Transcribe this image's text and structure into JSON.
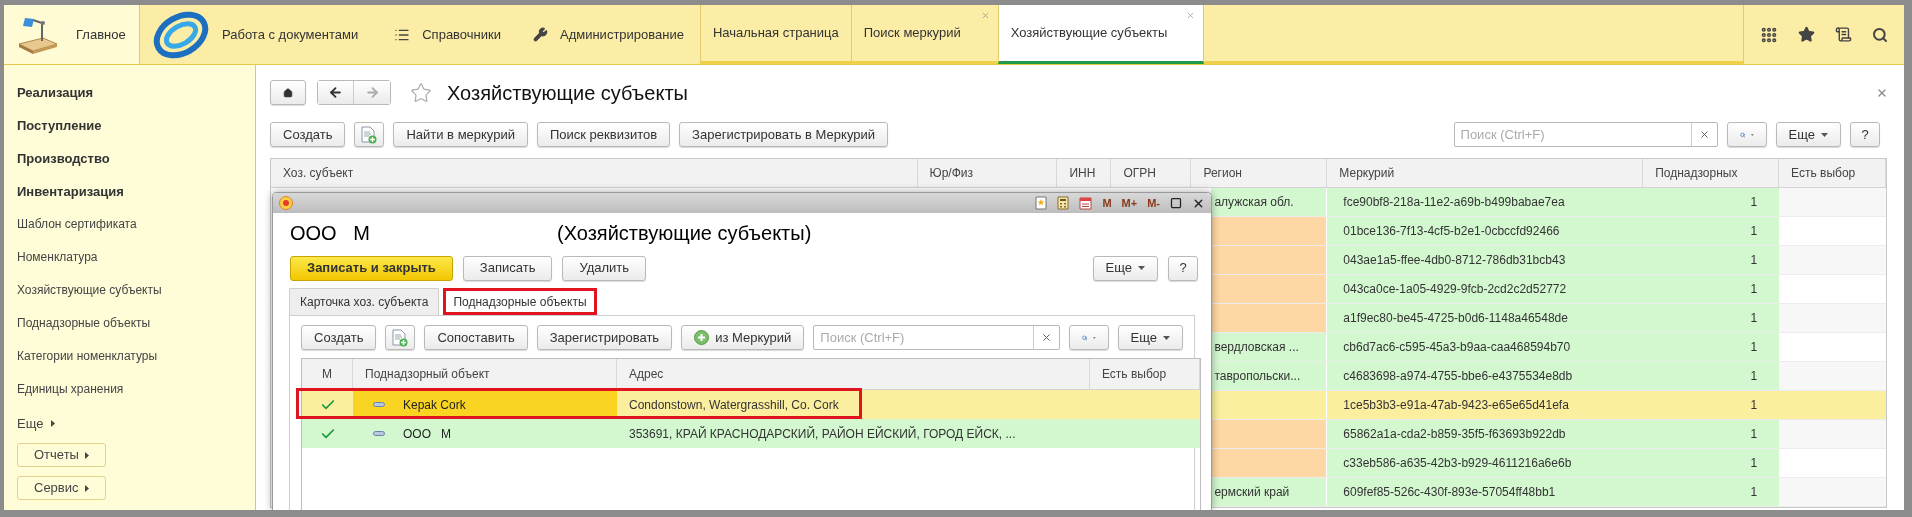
{
  "top_bar": {
    "home": {
      "label": "Главное"
    },
    "sections": [
      {
        "label": "Работа с документами",
        "kind": "logo"
      },
      {
        "label": "Справочники",
        "kind": "list"
      },
      {
        "label": "Администрирование",
        "kind": "wrench"
      }
    ],
    "tabs": [
      {
        "label": "Начальная страница",
        "selected": false,
        "closable": false
      },
      {
        "label": "Поиск меркурий",
        "selected": false,
        "closable": true
      },
      {
        "label": "Хозяйствующие субъекты",
        "selected": true,
        "closable": true
      }
    ]
  },
  "sidebar": {
    "items": [
      {
        "label": "Реализация",
        "kind": "section"
      },
      {
        "label": "Поступление",
        "kind": "section"
      },
      {
        "label": "Производство",
        "kind": "section"
      },
      {
        "label": "Инвентаризация",
        "kind": "section"
      },
      {
        "label": "Шаблон сертификата",
        "kind": "link"
      },
      {
        "label": "Номенклатура",
        "kind": "link"
      },
      {
        "label": "Хозяйствующие субъекты",
        "kind": "link"
      },
      {
        "label": "Поднадзорные объекты",
        "kind": "link"
      },
      {
        "label": "Категории номенклатуры",
        "kind": "link"
      },
      {
        "label": "Единицы хранения",
        "kind": "link"
      },
      {
        "label": "Еще",
        "kind": "more"
      },
      {
        "label": "Отчеты",
        "kind": "button"
      },
      {
        "label": "Сервис",
        "kind": "button"
      }
    ]
  },
  "page": {
    "title": "Хозяйствующие субъекты",
    "toolbar": [
      {
        "kind": "text",
        "label": "Создать"
      },
      {
        "kind": "icon"
      },
      {
        "kind": "text",
        "label": "Найти в меркурий"
      },
      {
        "kind": "text",
        "label": "Поиск реквизитов"
      },
      {
        "kind": "text",
        "label": "Зарегистрировать в Меркурий"
      }
    ],
    "search": {
      "placeholder": "Поиск (Ctrl+F)"
    },
    "more": "Еще",
    "help": "?"
  },
  "table": {
    "columns": [
      "Хоз. субъект",
      "Юр/Физ",
      "ИНН",
      "ОГРН",
      "Регион",
      "Меркурий",
      "Поднадзорных",
      "Есть выбор"
    ],
    "rows": [
      {
        "region": "алужская обл.",
        "color": "#d3f8d0",
        "mercury": "fce90bf8-218a-11e2-a69b-b499babae7ea",
        "count": "1",
        "selected": false
      },
      {
        "color": "#fdd8a4",
        "mercury": "01bce136-7f13-4cf5-b2e1-0cbccfd92466",
        "count": "1",
        "selected": false
      },
      {
        "color": "#fdd8a4",
        "mercury": "043ae1a5-ffee-4db0-8712-786db31bcb43",
        "count": "1",
        "selected": false
      },
      {
        "color": "#fdd8a4",
        "mercury": "043ca0ce-1a05-4929-9fcb-2cd2c2d52772",
        "count": "1",
        "selected": false
      },
      {
        "color": "#fdd8a4",
        "mercury": "a1f9ec80-be45-4725-b0d6-1148a46548de",
        "count": "1",
        "selected": false
      },
      {
        "region": "вердловская ...",
        "color": "#d3f8d0",
        "mercury": "cb6d7ac6-c595-45a3-b9aa-caa468594b70",
        "count": "1",
        "selected": false
      },
      {
        "region": "тавропольски...",
        "color": "#d3f8d0",
        "mercury": "c4683698-a974-4755-bbe6-e4375534e8db",
        "count": "1",
        "selected": false
      },
      {
        "color": "#fcee9f",
        "mercury": "1ce5b3b3-e91a-47ab-9423-e65e65d41efa",
        "count": "1",
        "selected": true
      },
      {
        "color": "#fdd8a4",
        "mercury": "65862a1a-cda2-b859-35f5-f63693b922db",
        "count": "1",
        "selected": false
      },
      {
        "color": "#fdd8a4",
        "mercury": "c33eb586-a635-42b3-b929-4611216a6e6b",
        "count": "1",
        "selected": false
      },
      {
        "region": "ермский край",
        "color": "#d3f8d0",
        "mercury": "609fef85-526c-430f-893e-57054ff48bb1",
        "count": "1",
        "selected": false
      }
    ]
  },
  "dialog": {
    "memory_buttons": [
      "M",
      "M+",
      "M-"
    ],
    "title": "ООО   М",
    "subtitle": "(Хозяйствующие субъекты)",
    "buttons": [
      {
        "label": "Записать и закрыть",
        "kind": "primary"
      },
      {
        "label": "Записать",
        "kind": "default"
      },
      {
        "label": "Удалить",
        "kind": "default"
      }
    ],
    "more": "Еще",
    "help": "?",
    "tabs": [
      {
        "label": "Карточка хоз. субъекта",
        "selected": false,
        "highlighted": false
      },
      {
        "label": "Поднадзорные объекты",
        "selected": true,
        "highlighted": true
      }
    ],
    "toolbar": [
      {
        "kind": "text",
        "label": "Создать"
      },
      {
        "kind": "icon"
      },
      {
        "kind": "text",
        "label": "Сопоставить"
      },
      {
        "kind": "text",
        "label": "Зарегистрировать"
      },
      {
        "kind": "add",
        "label": "из Меркурий"
      }
    ],
    "search": {
      "placeholder": "Поиск (Ctrl+F)"
    },
    "toolbar_more": "Еще",
    "table": {
      "columns": [
        "М",
        "Поднадзорный объект",
        "Адрес",
        "Есть выбор"
      ],
      "rows": [
        {
          "checked": true,
          "object": "Kepak Cork",
          "address": "Condonstown, Watergrasshill, Co. Cork",
          "selected": true,
          "highlighted": true
        },
        {
          "checked": true,
          "object": "ООО   М",
          "address": "353691, КРАЙ КРАСНОДАРСКИЙ, РАЙОН ЕЙСКИЙ, ГОРОД ЕЙСК, ...",
          "selected": false,
          "highlighted": false
        }
      ]
    }
  }
}
